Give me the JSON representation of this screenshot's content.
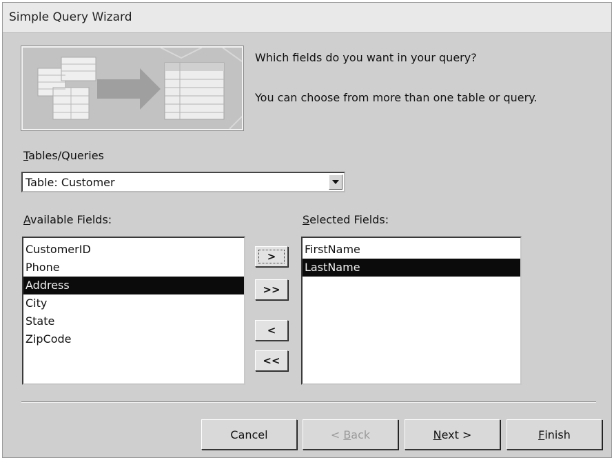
{
  "window": {
    "title": "Simple Query Wizard"
  },
  "prompt": {
    "question": "Which fields do you want in your query?",
    "hint": "You can choose from more than one table or query."
  },
  "tables_queries": {
    "label_mnemonic": "T",
    "label_rest": "ables/Queries",
    "selected_value": "Table: Customer"
  },
  "available_fields": {
    "label_mnemonic": "A",
    "label_rest": "vailable Fields:",
    "items": [
      "CustomerID",
      "Phone",
      "Address",
      "City",
      "State",
      "ZipCode"
    ],
    "selected_item": "Address"
  },
  "selected_fields": {
    "label_mnemonic": "S",
    "label_rest": "elected Fields:",
    "items": [
      "FirstName",
      "LastName"
    ],
    "selected_item": "LastName"
  },
  "move_buttons": {
    "add_one": ">",
    "add_all": ">>",
    "remove_one": "<",
    "remove_all": "<<"
  },
  "footer_buttons": {
    "cancel": "Cancel",
    "back_prefix": "< ",
    "back_mnemonic": "B",
    "back_rest": "ack",
    "back_enabled": false,
    "next_mnemonic": "N",
    "next_rest": "ext >",
    "finish_mnemonic": "F",
    "finish_rest": "inish"
  },
  "icons": {
    "dropdown": "chevron-down-icon",
    "wizard_illustration": "table-to-table-icon"
  }
}
